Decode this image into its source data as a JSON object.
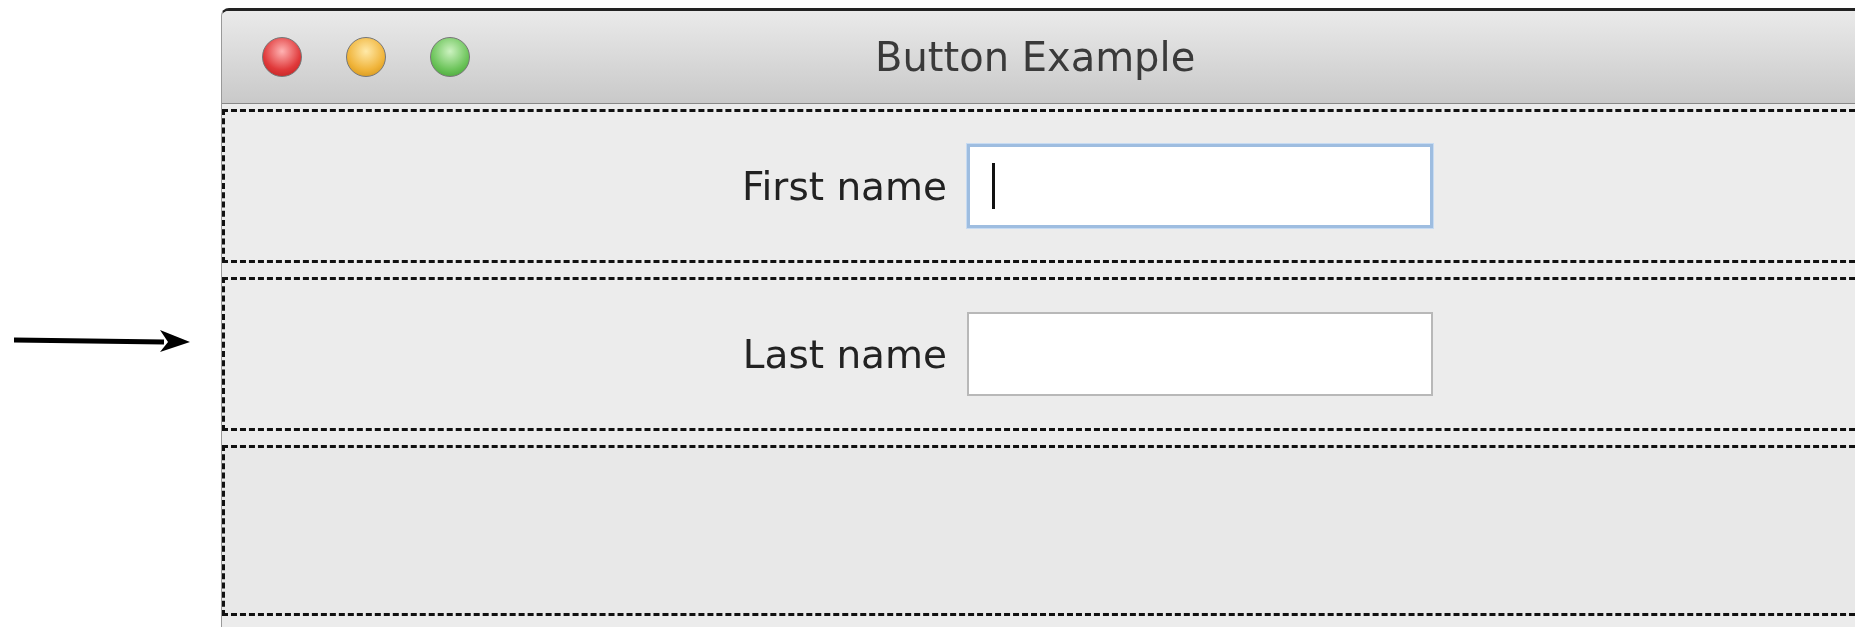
{
  "window": {
    "title": "Button Example"
  },
  "panels": [
    {
      "kind": "field",
      "label": "First name",
      "focused": true
    },
    {
      "kind": "field",
      "label": "Last name",
      "focused": false
    },
    {
      "kind": "empty"
    }
  ]
}
